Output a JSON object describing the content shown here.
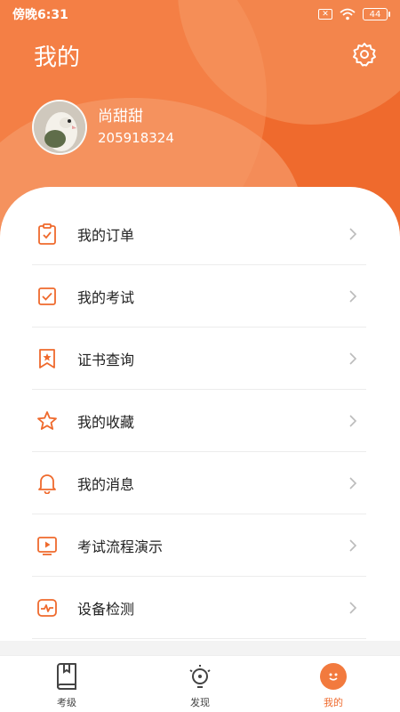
{
  "status_bar": {
    "time": "傍晚6:31",
    "battery": "44"
  },
  "header": {
    "title": "我的"
  },
  "user": {
    "name": "尚甜甜",
    "id": "205918324"
  },
  "menu": [
    {
      "label": "我的订单",
      "icon": "clipboard-icon"
    },
    {
      "label": "我的考试",
      "icon": "exam-check-icon"
    },
    {
      "label": "证书查询",
      "icon": "bookmark-star-icon"
    },
    {
      "label": "我的收藏",
      "icon": "star-icon"
    },
    {
      "label": "我的消息",
      "icon": "bell-icon"
    },
    {
      "label": "考试流程演示",
      "icon": "video-play-icon"
    },
    {
      "label": "设备检测",
      "icon": "monitor-pulse-icon"
    }
  ],
  "tabbar": [
    {
      "label": "考级",
      "icon": "book-icon",
      "active": false
    },
    {
      "label": "发现",
      "icon": "lightbulb-icon",
      "active": false
    },
    {
      "label": "我的",
      "icon": "smiley-icon",
      "active": true
    }
  ],
  "colors": {
    "accent": "#ef6a2d",
    "text": "#222222",
    "chevron": "#bbbbbb"
  }
}
